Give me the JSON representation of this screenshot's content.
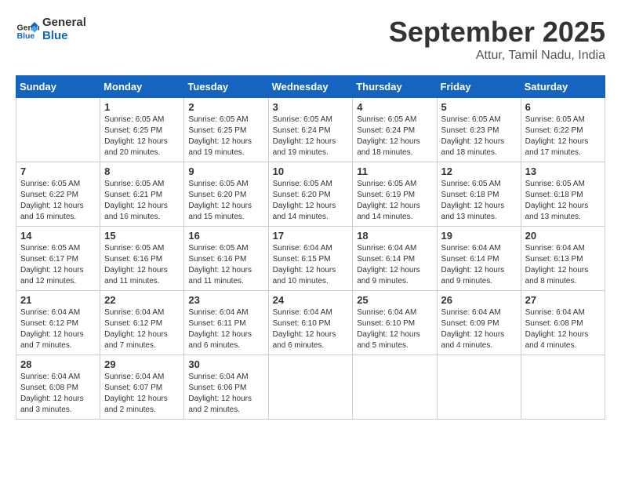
{
  "header": {
    "logo_text_general": "General",
    "logo_text_blue": "Blue",
    "month": "September 2025",
    "location": "Attur, Tamil Nadu, India"
  },
  "days_of_week": [
    "Sunday",
    "Monday",
    "Tuesday",
    "Wednesday",
    "Thursday",
    "Friday",
    "Saturday"
  ],
  "weeks": [
    [
      {
        "day": "",
        "info": ""
      },
      {
        "day": "1",
        "info": "Sunrise: 6:05 AM\nSunset: 6:25 PM\nDaylight: 12 hours\nand 20 minutes."
      },
      {
        "day": "2",
        "info": "Sunrise: 6:05 AM\nSunset: 6:25 PM\nDaylight: 12 hours\nand 19 minutes."
      },
      {
        "day": "3",
        "info": "Sunrise: 6:05 AM\nSunset: 6:24 PM\nDaylight: 12 hours\nand 19 minutes."
      },
      {
        "day": "4",
        "info": "Sunrise: 6:05 AM\nSunset: 6:24 PM\nDaylight: 12 hours\nand 18 minutes."
      },
      {
        "day": "5",
        "info": "Sunrise: 6:05 AM\nSunset: 6:23 PM\nDaylight: 12 hours\nand 18 minutes."
      },
      {
        "day": "6",
        "info": "Sunrise: 6:05 AM\nSunset: 6:22 PM\nDaylight: 12 hours\nand 17 minutes."
      }
    ],
    [
      {
        "day": "7",
        "info": "Sunrise: 6:05 AM\nSunset: 6:22 PM\nDaylight: 12 hours\nand 16 minutes."
      },
      {
        "day": "8",
        "info": "Sunrise: 6:05 AM\nSunset: 6:21 PM\nDaylight: 12 hours\nand 16 minutes."
      },
      {
        "day": "9",
        "info": "Sunrise: 6:05 AM\nSunset: 6:20 PM\nDaylight: 12 hours\nand 15 minutes."
      },
      {
        "day": "10",
        "info": "Sunrise: 6:05 AM\nSunset: 6:20 PM\nDaylight: 12 hours\nand 14 minutes."
      },
      {
        "day": "11",
        "info": "Sunrise: 6:05 AM\nSunset: 6:19 PM\nDaylight: 12 hours\nand 14 minutes."
      },
      {
        "day": "12",
        "info": "Sunrise: 6:05 AM\nSunset: 6:18 PM\nDaylight: 12 hours\nand 13 minutes."
      },
      {
        "day": "13",
        "info": "Sunrise: 6:05 AM\nSunset: 6:18 PM\nDaylight: 12 hours\nand 13 minutes."
      }
    ],
    [
      {
        "day": "14",
        "info": "Sunrise: 6:05 AM\nSunset: 6:17 PM\nDaylight: 12 hours\nand 12 minutes."
      },
      {
        "day": "15",
        "info": "Sunrise: 6:05 AM\nSunset: 6:16 PM\nDaylight: 12 hours\nand 11 minutes."
      },
      {
        "day": "16",
        "info": "Sunrise: 6:05 AM\nSunset: 6:16 PM\nDaylight: 12 hours\nand 11 minutes."
      },
      {
        "day": "17",
        "info": "Sunrise: 6:04 AM\nSunset: 6:15 PM\nDaylight: 12 hours\nand 10 minutes."
      },
      {
        "day": "18",
        "info": "Sunrise: 6:04 AM\nSunset: 6:14 PM\nDaylight: 12 hours\nand 9 minutes."
      },
      {
        "day": "19",
        "info": "Sunrise: 6:04 AM\nSunset: 6:14 PM\nDaylight: 12 hours\nand 9 minutes."
      },
      {
        "day": "20",
        "info": "Sunrise: 6:04 AM\nSunset: 6:13 PM\nDaylight: 12 hours\nand 8 minutes."
      }
    ],
    [
      {
        "day": "21",
        "info": "Sunrise: 6:04 AM\nSunset: 6:12 PM\nDaylight: 12 hours\nand 7 minutes."
      },
      {
        "day": "22",
        "info": "Sunrise: 6:04 AM\nSunset: 6:12 PM\nDaylight: 12 hours\nand 7 minutes."
      },
      {
        "day": "23",
        "info": "Sunrise: 6:04 AM\nSunset: 6:11 PM\nDaylight: 12 hours\nand 6 minutes."
      },
      {
        "day": "24",
        "info": "Sunrise: 6:04 AM\nSunset: 6:10 PM\nDaylight: 12 hours\nand 6 minutes."
      },
      {
        "day": "25",
        "info": "Sunrise: 6:04 AM\nSunset: 6:10 PM\nDaylight: 12 hours\nand 5 minutes."
      },
      {
        "day": "26",
        "info": "Sunrise: 6:04 AM\nSunset: 6:09 PM\nDaylight: 12 hours\nand 4 minutes."
      },
      {
        "day": "27",
        "info": "Sunrise: 6:04 AM\nSunset: 6:08 PM\nDaylight: 12 hours\nand 4 minutes."
      }
    ],
    [
      {
        "day": "28",
        "info": "Sunrise: 6:04 AM\nSunset: 6:08 PM\nDaylight: 12 hours\nand 3 minutes."
      },
      {
        "day": "29",
        "info": "Sunrise: 6:04 AM\nSunset: 6:07 PM\nDaylight: 12 hours\nand 2 minutes."
      },
      {
        "day": "30",
        "info": "Sunrise: 6:04 AM\nSunset: 6:06 PM\nDaylight: 12 hours\nand 2 minutes."
      },
      {
        "day": "",
        "info": ""
      },
      {
        "day": "",
        "info": ""
      },
      {
        "day": "",
        "info": ""
      },
      {
        "day": "",
        "info": ""
      }
    ]
  ]
}
